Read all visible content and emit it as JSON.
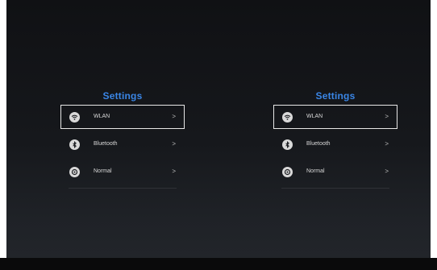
{
  "left_panel": {
    "title": "Settings",
    "items": [
      {
        "label": "WLAN",
        "chevron": ">",
        "icon": "wifi-icon",
        "selected": true
      },
      {
        "label": "Bluetooth",
        "chevron": ">",
        "icon": "bluetooth-icon",
        "selected": false
      },
      {
        "label": "Normal",
        "chevron": ">",
        "icon": "settings-icon",
        "selected": false
      }
    ]
  },
  "right_panel": {
    "title": "Settings",
    "items": [
      {
        "label": "WLAN",
        "chevron": ">",
        "icon": "wifi-icon",
        "selected": true
      },
      {
        "label": "Bluetooth",
        "chevron": ">",
        "icon": "bluetooth-icon",
        "selected": false
      },
      {
        "label": "Normal",
        "chevron": ">",
        "icon": "settings-icon",
        "selected": false
      }
    ]
  },
  "colors": {
    "accent": "#3a86e6",
    "background": "#16181c",
    "text": "#d8d8d8",
    "selection_border": "#e8e8e8"
  }
}
